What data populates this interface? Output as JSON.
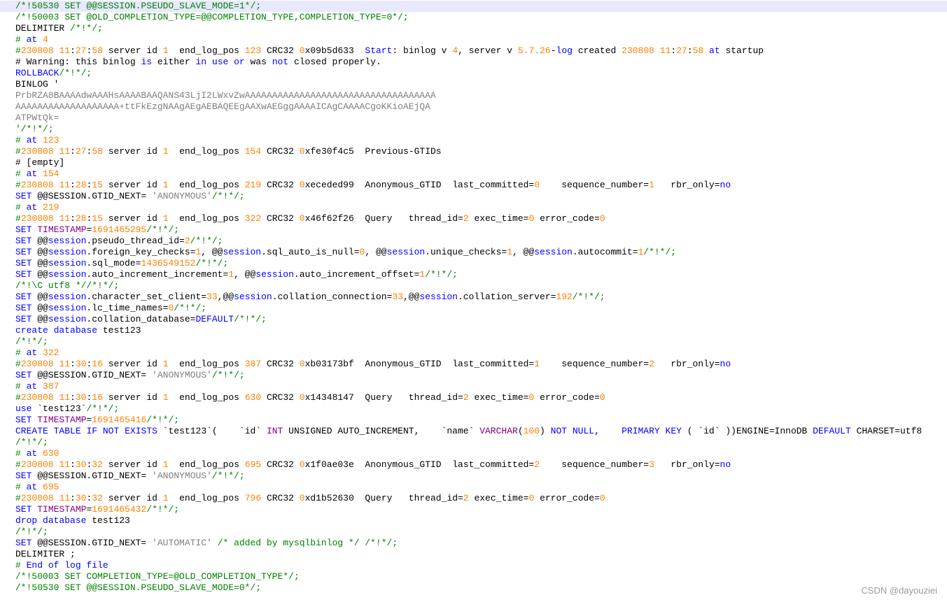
{
  "colors": {
    "default": "#000000",
    "comment": "#008000",
    "keyword": "#0000ff",
    "number": "#ff8000",
    "string": "#808080",
    "function": "#800080",
    "current_line_bg": "#e8e8ff",
    "watermark": "#9a9a9a"
  },
  "watermark": "CSDN @dayouziei",
  "lines": [
    [
      [
        "/*!50530 SET @@SESSION.PSEUDO_SLAVE_MODE=1*/;",
        "c"
      ]
    ],
    [
      [
        "/*!50003 SET @OLD_COMPLETION_TYPE=@@COMPLETION_TYPE,COMPLETION_TYPE=0*/;",
        "c"
      ]
    ],
    [
      [
        "DELIMITER ",
        ""
      ],
      [
        "/*!*/;",
        "c"
      ]
    ],
    [
      [
        "# ",
        "c"
      ],
      [
        "at",
        "k"
      ],
      [
        " ",
        ""
      ],
      [
        "4",
        "n"
      ]
    ],
    [
      [
        "#",
        "c"
      ],
      [
        "230808",
        "n"
      ],
      [
        " ",
        ""
      ],
      [
        "11",
        "n"
      ],
      [
        ":",
        ""
      ],
      [
        "27",
        "n"
      ],
      [
        ":",
        ""
      ],
      [
        "58",
        "n"
      ],
      [
        " server id ",
        ""
      ],
      [
        "1",
        "n"
      ],
      [
        "  end_log_pos ",
        ""
      ],
      [
        "123",
        "n"
      ],
      [
        " CRC32 ",
        ""
      ],
      [
        "0",
        "n"
      ],
      [
        "x09b5d633  ",
        ""
      ],
      [
        "Start",
        "k"
      ],
      [
        ": binlog v ",
        ""
      ],
      [
        "4",
        "n"
      ],
      [
        ", server v ",
        ""
      ],
      [
        "5.7.26",
        "n"
      ],
      [
        "-",
        ""
      ],
      [
        "log",
        "k"
      ],
      [
        " created ",
        ""
      ],
      [
        "230808",
        "n"
      ],
      [
        " ",
        ""
      ],
      [
        "11",
        "n"
      ],
      [
        ":",
        ""
      ],
      [
        "27",
        "n"
      ],
      [
        ":",
        ""
      ],
      [
        "58",
        "n"
      ],
      [
        " ",
        ""
      ],
      [
        "at",
        "k"
      ],
      [
        " startup",
        ""
      ]
    ],
    [
      [
        "# Warning: this binlog ",
        ""
      ],
      [
        "is",
        "k"
      ],
      [
        " either ",
        ""
      ],
      [
        "in",
        "k"
      ],
      [
        " ",
        ""
      ],
      [
        "use",
        "k"
      ],
      [
        " ",
        ""
      ],
      [
        "or",
        "k"
      ],
      [
        " was ",
        ""
      ],
      [
        "not",
        "k"
      ],
      [
        " closed properly.",
        ""
      ]
    ],
    [
      [
        "ROLLBACK",
        "k"
      ],
      [
        "/*!*/;",
        "c"
      ]
    ],
    [
      [
        "BINLOG '",
        ""
      ]
    ],
    [
      [
        "PrbRZA8BAAAAdwAAAHsAAAABAAQANS43LjI2LWxvZwAAAAAAAAAAAAAAAAAAAAAAAAAAAAAAAAAAA",
        "s"
      ]
    ],
    [
      [
        "AAAAAAAAAAAAAAAAAAA+ttFkEzgNAAgAEgAEBAQEEgAAXwAEGggAAAAICAgCAAAACgoKKioAEjQA",
        "s"
      ]
    ],
    [
      [
        "ATPWtQk=",
        "s"
      ]
    ],
    [
      [
        "'/*!*/;",
        "c"
      ]
    ],
    [
      [
        "# ",
        "c"
      ],
      [
        "at",
        "k"
      ],
      [
        " ",
        ""
      ],
      [
        "123",
        "n"
      ]
    ],
    [
      [
        "#",
        "c"
      ],
      [
        "230808",
        "n"
      ],
      [
        " ",
        ""
      ],
      [
        "11",
        "n"
      ],
      [
        ":",
        ""
      ],
      [
        "27",
        "n"
      ],
      [
        ":",
        ""
      ],
      [
        "58",
        "n"
      ],
      [
        " server id ",
        ""
      ],
      [
        "1",
        "n"
      ],
      [
        "  end_log_pos ",
        ""
      ],
      [
        "154",
        "n"
      ],
      [
        " CRC32 ",
        ""
      ],
      [
        "0",
        "n"
      ],
      [
        "xfe30f4c5  Previous-GTIDs",
        ""
      ]
    ],
    [
      [
        "# [empty]",
        ""
      ]
    ],
    [
      [
        "# ",
        "c"
      ],
      [
        "at",
        "k"
      ],
      [
        " ",
        ""
      ],
      [
        "154",
        "n"
      ]
    ],
    [
      [
        "#",
        "c"
      ],
      [
        "230808",
        "n"
      ],
      [
        " ",
        ""
      ],
      [
        "11",
        "n"
      ],
      [
        ":",
        ""
      ],
      [
        "28",
        "n"
      ],
      [
        ":",
        ""
      ],
      [
        "15",
        "n"
      ],
      [
        " server id ",
        ""
      ],
      [
        "1",
        "n"
      ],
      [
        "  end_log_pos ",
        ""
      ],
      [
        "219",
        "n"
      ],
      [
        " CRC32 ",
        ""
      ],
      [
        "0",
        "n"
      ],
      [
        "xeceded99  Anonymous_GTID  last_committed=",
        ""
      ],
      [
        "0",
        "n"
      ],
      [
        "    sequence_number=",
        ""
      ],
      [
        "1",
        "n"
      ],
      [
        "   rbr_only=",
        ""
      ],
      [
        "no",
        "k"
      ]
    ],
    [
      [
        "SET",
        "k"
      ],
      [
        " @@SESSION.GTID_NEXT= ",
        ""
      ],
      [
        "'ANONYMOUS'",
        "s"
      ],
      [
        "/*!*/;",
        "c"
      ]
    ],
    [
      [
        "# ",
        "c"
      ],
      [
        "at",
        "k"
      ],
      [
        " ",
        ""
      ],
      [
        "219",
        "n"
      ]
    ],
    [
      [
        "#",
        "c"
      ],
      [
        "230808",
        "n"
      ],
      [
        " ",
        ""
      ],
      [
        "11",
        "n"
      ],
      [
        ":",
        ""
      ],
      [
        "28",
        "n"
      ],
      [
        ":",
        ""
      ],
      [
        "15",
        "n"
      ],
      [
        " server id ",
        ""
      ],
      [
        "1",
        "n"
      ],
      [
        "  end_log_pos ",
        ""
      ],
      [
        "322",
        "n"
      ],
      [
        " CRC32 ",
        ""
      ],
      [
        "0",
        "n"
      ],
      [
        "x46f62f26  Query   thread_id=",
        ""
      ],
      [
        "2",
        "n"
      ],
      [
        " exec_time=",
        ""
      ],
      [
        "0",
        "n"
      ],
      [
        " error_code=",
        ""
      ],
      [
        "0",
        "n"
      ]
    ],
    [
      [
        "SET",
        "k"
      ],
      [
        " ",
        ""
      ],
      [
        "TIMESTAMP",
        "f"
      ],
      [
        "=",
        ""
      ],
      [
        "1691465295",
        "n"
      ],
      [
        "/*!*/;",
        "c"
      ]
    ],
    [
      [
        "SET",
        "k"
      ],
      [
        " @@",
        ""
      ],
      [
        "session",
        "k"
      ],
      [
        ".pseudo_thread_id=",
        ""
      ],
      [
        "2",
        "n"
      ],
      [
        "/*!*/;",
        "c"
      ]
    ],
    [
      [
        "SET",
        "k"
      ],
      [
        " @@",
        ""
      ],
      [
        "session",
        "k"
      ],
      [
        ".foreign_key_checks=",
        ""
      ],
      [
        "1",
        "n"
      ],
      [
        ", @@",
        ""
      ],
      [
        "session",
        "k"
      ],
      [
        ".sql_auto_is_null=",
        ""
      ],
      [
        "0",
        "n"
      ],
      [
        ", @@",
        ""
      ],
      [
        "session",
        "k"
      ],
      [
        ".unique_checks=",
        ""
      ],
      [
        "1",
        "n"
      ],
      [
        ", @@",
        ""
      ],
      [
        "session",
        "k"
      ],
      [
        ".autocommit=",
        ""
      ],
      [
        "1",
        "n"
      ],
      [
        "/*!*/;",
        "c"
      ]
    ],
    [
      [
        "SET",
        "k"
      ],
      [
        " @@",
        ""
      ],
      [
        "session",
        "k"
      ],
      [
        ".sql_mode=",
        ""
      ],
      [
        "1436549152",
        "n"
      ],
      [
        "/*!*/;",
        "c"
      ]
    ],
    [
      [
        "SET",
        "k"
      ],
      [
        " @@",
        ""
      ],
      [
        "session",
        "k"
      ],
      [
        ".auto_increment_increment=",
        ""
      ],
      [
        "1",
        "n"
      ],
      [
        ", @@",
        ""
      ],
      [
        "session",
        "k"
      ],
      [
        ".auto_increment_offset=",
        ""
      ],
      [
        "1",
        "n"
      ],
      [
        "/*!*/;",
        "c"
      ]
    ],
    [
      [
        "/*!\\C utf8 *//*!*/;",
        "c"
      ]
    ],
    [
      [
        "SET",
        "k"
      ],
      [
        " @@",
        ""
      ],
      [
        "session",
        "k"
      ],
      [
        ".character_set_client=",
        ""
      ],
      [
        "33",
        "n"
      ],
      [
        ",@@",
        ""
      ],
      [
        "session",
        "k"
      ],
      [
        ".collation_connection=",
        ""
      ],
      [
        "33",
        "n"
      ],
      [
        ",@@",
        ""
      ],
      [
        "session",
        "k"
      ],
      [
        ".collation_server=",
        ""
      ],
      [
        "192",
        "n"
      ],
      [
        "/*!*/;",
        "c"
      ]
    ],
    [
      [
        "SET",
        "k"
      ],
      [
        " @@",
        ""
      ],
      [
        "session",
        "k"
      ],
      [
        ".lc_time_names=",
        ""
      ],
      [
        "0",
        "n"
      ],
      [
        "/*!*/;",
        "c"
      ]
    ],
    [
      [
        "SET",
        "k"
      ],
      [
        " @@",
        ""
      ],
      [
        "session",
        "k"
      ],
      [
        ".collation_database=",
        ""
      ],
      [
        "DEFAULT",
        "k"
      ],
      [
        "/*!*/;",
        "c"
      ]
    ],
    [
      [
        "create",
        "k"
      ],
      [
        " ",
        ""
      ],
      [
        "database",
        "k"
      ],
      [
        " test123",
        ""
      ]
    ],
    [
      [
        "/*!*/;",
        "c"
      ]
    ],
    [
      [
        "# ",
        "c"
      ],
      [
        "at",
        "k"
      ],
      [
        " ",
        ""
      ],
      [
        "322",
        "n"
      ]
    ],
    [
      [
        "#",
        "c"
      ],
      [
        "230808",
        "n"
      ],
      [
        " ",
        ""
      ],
      [
        "11",
        "n"
      ],
      [
        ":",
        ""
      ],
      [
        "30",
        "n"
      ],
      [
        ":",
        ""
      ],
      [
        "16",
        "n"
      ],
      [
        " server id ",
        ""
      ],
      [
        "1",
        "n"
      ],
      [
        "  end_log_pos ",
        ""
      ],
      [
        "387",
        "n"
      ],
      [
        " CRC32 ",
        ""
      ],
      [
        "0",
        "n"
      ],
      [
        "xb03173bf  Anonymous_GTID  last_committed=",
        ""
      ],
      [
        "1",
        "n"
      ],
      [
        "    sequence_number=",
        ""
      ],
      [
        "2",
        "n"
      ],
      [
        "   rbr_only=",
        ""
      ],
      [
        "no",
        "k"
      ]
    ],
    [
      [
        "SET",
        "k"
      ],
      [
        " @@SESSION.GTID_NEXT= ",
        ""
      ],
      [
        "'ANONYMOUS'",
        "s"
      ],
      [
        "/*!*/;",
        "c"
      ]
    ],
    [
      [
        "# ",
        "c"
      ],
      [
        "at",
        "k"
      ],
      [
        " ",
        ""
      ],
      [
        "387",
        "n"
      ]
    ],
    [
      [
        "#",
        "c"
      ],
      [
        "230808",
        "n"
      ],
      [
        " ",
        ""
      ],
      [
        "11",
        "n"
      ],
      [
        ":",
        ""
      ],
      [
        "30",
        "n"
      ],
      [
        ":",
        ""
      ],
      [
        "16",
        "n"
      ],
      [
        " server id ",
        ""
      ],
      [
        "1",
        "n"
      ],
      [
        "  end_log_pos ",
        ""
      ],
      [
        "630",
        "n"
      ],
      [
        " CRC32 ",
        ""
      ],
      [
        "0",
        "n"
      ],
      [
        "x14348147  Query   thread_id=",
        ""
      ],
      [
        "2",
        "n"
      ],
      [
        " exec_time=",
        ""
      ],
      [
        "0",
        "n"
      ],
      [
        " error_code=",
        ""
      ],
      [
        "0",
        "n"
      ]
    ],
    [
      [
        "use",
        "k"
      ],
      [
        " `test123`",
        ""
      ],
      [
        "/*!*/;",
        "c"
      ]
    ],
    [
      [
        "SET",
        "k"
      ],
      [
        " ",
        ""
      ],
      [
        "TIMESTAMP",
        "f"
      ],
      [
        "=",
        ""
      ],
      [
        "1691465416",
        "n"
      ],
      [
        "/*!*/;",
        "c"
      ]
    ],
    [
      [
        "CREATE",
        "k"
      ],
      [
        " ",
        ""
      ],
      [
        "TABLE",
        "k"
      ],
      [
        " ",
        ""
      ],
      [
        "IF",
        "k"
      ],
      [
        " ",
        ""
      ],
      [
        "NOT",
        "k"
      ],
      [
        " ",
        ""
      ],
      [
        "EXISTS",
        "k"
      ],
      [
        " `test123`(    `id` ",
        ""
      ],
      [
        "INT",
        "f"
      ],
      [
        " UNSIGNED AUTO_INCREMENT,    `name` ",
        ""
      ],
      [
        "VARCHAR",
        "f"
      ],
      [
        "(",
        ""
      ],
      [
        "100",
        "n"
      ],
      [
        ") ",
        ""
      ],
      [
        "NOT",
        "k"
      ],
      [
        " ",
        ""
      ],
      [
        "NULL",
        "k"
      ],
      [
        ",    ",
        ""
      ],
      [
        "PRIMARY",
        "k"
      ],
      [
        " ",
        ""
      ],
      [
        "KEY",
        "k"
      ],
      [
        " ( `id` ))ENGINE=InnoDB ",
        ""
      ],
      [
        "DEFAULT",
        "k"
      ],
      [
        " CHARSET=utf8",
        ""
      ]
    ],
    [
      [
        "/*!*/;",
        "c"
      ]
    ],
    [
      [
        "# ",
        "c"
      ],
      [
        "at",
        "k"
      ],
      [
        " ",
        ""
      ],
      [
        "630",
        "n"
      ]
    ],
    [
      [
        "#",
        "c"
      ],
      [
        "230808",
        "n"
      ],
      [
        " ",
        ""
      ],
      [
        "11",
        "n"
      ],
      [
        ":",
        ""
      ],
      [
        "30",
        "n"
      ],
      [
        ":",
        ""
      ],
      [
        "32",
        "n"
      ],
      [
        " server id ",
        ""
      ],
      [
        "1",
        "n"
      ],
      [
        "  end_log_pos ",
        ""
      ],
      [
        "695",
        "n"
      ],
      [
        " CRC32 ",
        ""
      ],
      [
        "0",
        "n"
      ],
      [
        "x1f0ae03e  Anonymous_GTID  last_committed=",
        ""
      ],
      [
        "2",
        "n"
      ],
      [
        "    sequence_number=",
        ""
      ],
      [
        "3",
        "n"
      ],
      [
        "   rbr_only=",
        ""
      ],
      [
        "no",
        "k"
      ]
    ],
    [
      [
        "SET",
        "k"
      ],
      [
        " @@SESSION.GTID_NEXT= ",
        ""
      ],
      [
        "'ANONYMOUS'",
        "s"
      ],
      [
        "/*!*/;",
        "c"
      ]
    ],
    [
      [
        "# ",
        "c"
      ],
      [
        "at",
        "k"
      ],
      [
        " ",
        ""
      ],
      [
        "695",
        "n"
      ]
    ],
    [
      [
        "#",
        "c"
      ],
      [
        "230808",
        "n"
      ],
      [
        " ",
        ""
      ],
      [
        "11",
        "n"
      ],
      [
        ":",
        ""
      ],
      [
        "30",
        "n"
      ],
      [
        ":",
        ""
      ],
      [
        "32",
        "n"
      ],
      [
        " server id ",
        ""
      ],
      [
        "1",
        "n"
      ],
      [
        "  end_log_pos ",
        ""
      ],
      [
        "796",
        "n"
      ],
      [
        " CRC32 ",
        ""
      ],
      [
        "0",
        "n"
      ],
      [
        "xd1b52630  Query   thread_id=",
        ""
      ],
      [
        "2",
        "n"
      ],
      [
        " exec_time=",
        ""
      ],
      [
        "0",
        "n"
      ],
      [
        " error_code=",
        ""
      ],
      [
        "0",
        "n"
      ]
    ],
    [
      [
        "SET",
        "k"
      ],
      [
        " ",
        ""
      ],
      [
        "TIMESTAMP",
        "f"
      ],
      [
        "=",
        ""
      ],
      [
        "1691465432",
        "n"
      ],
      [
        "/*!*/;",
        "c"
      ]
    ],
    [
      [
        "drop",
        "k"
      ],
      [
        " ",
        ""
      ],
      [
        "database",
        "k"
      ],
      [
        " test123",
        ""
      ]
    ],
    [
      [
        "/*!*/;",
        "c"
      ]
    ],
    [
      [
        "SET",
        "k"
      ],
      [
        " @@SESSION.GTID_NEXT= ",
        ""
      ],
      [
        "'AUTOMATIC'",
        "s"
      ],
      [
        " /* added by mysqlbinlog */ /*!*/;",
        "c"
      ]
    ],
    [
      [
        "DELIMITER ;",
        ""
      ]
    ],
    [
      [
        "# ",
        "c"
      ],
      [
        "End",
        "k"
      ],
      [
        " ",
        ""
      ],
      [
        "of",
        "k"
      ],
      [
        " ",
        ""
      ],
      [
        "log",
        "k"
      ],
      [
        " ",
        ""
      ],
      [
        "file",
        "k"
      ]
    ],
    [
      [
        "/*!50003 SET COMPLETION_TYPE=@OLD_COMPLETION_TYPE*/;",
        "c"
      ]
    ],
    [
      [
        "/*!50530 SET @@SESSION.PSEUDO_SLAVE_MODE=0*/;",
        "c"
      ]
    ]
  ]
}
